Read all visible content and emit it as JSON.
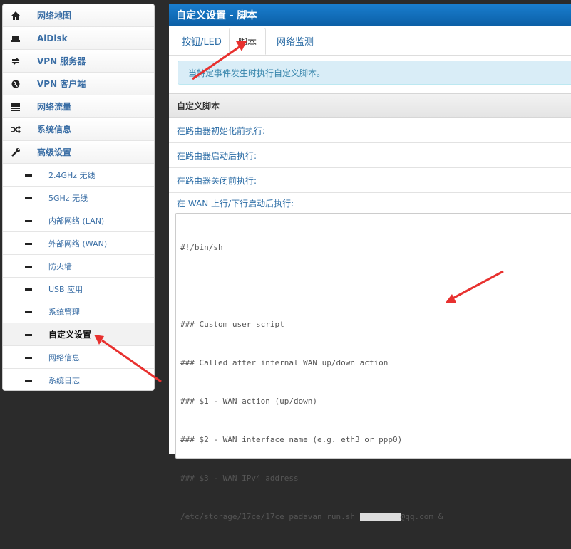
{
  "sidebar": {
    "items": [
      {
        "label": "网络地图",
        "icon": "home-icon"
      },
      {
        "label": "AiDisk",
        "icon": "disk-icon"
      },
      {
        "label": "VPN 服务器",
        "icon": "vpn-server-icon"
      },
      {
        "label": "VPN 客户端",
        "icon": "globe-icon"
      },
      {
        "label": "网络流量",
        "icon": "traffic-icon"
      },
      {
        "label": "系统信息",
        "icon": "shuffle-icon"
      },
      {
        "label": "高级设置",
        "icon": "wrench-icon"
      }
    ],
    "sub_items": [
      {
        "label": "2.4GHz 无线"
      },
      {
        "label": "5GHz 无线"
      },
      {
        "label": "内部网络 (LAN)"
      },
      {
        "label": "外部网络 (WAN)"
      },
      {
        "label": "防火墙"
      },
      {
        "label": "USB 应用"
      },
      {
        "label": "系统管理"
      },
      {
        "label": "自定义设置"
      },
      {
        "label": "网络信息"
      },
      {
        "label": "系统日志"
      }
    ],
    "active_sub_index": 7
  },
  "panel": {
    "title": "自定义设置 - 脚本",
    "tabs": [
      {
        "label": "按钮/LED"
      },
      {
        "label": "脚本"
      },
      {
        "label": "网络监测"
      }
    ],
    "active_tab_index": 1,
    "info_text": "当特定事件发生时执行自定义脚本。",
    "section_title": "自定义脚本",
    "rows": [
      {
        "label": "在路由器初始化前执行:"
      },
      {
        "label": "在路由器启动后执行:"
      },
      {
        "label": "在路由器关闭前执行:"
      },
      {
        "label": "在 WAN 上行/下行启动后执行:"
      }
    ],
    "script_lines": [
      "#!/bin/sh",
      "",
      "### Custom user script",
      "### Called after internal WAN up/down action",
      "### $1 - WAN action (up/down)",
      "### $2 - WAN interface name (e.g. eth3 or ppp0)",
      "### $3 - WAN IPv4 address"
    ],
    "script_last_line_prefix": "/etc/storage/17ce/17ce_padavan_run.sh ",
    "script_last_line_suffix": "@qq.com &"
  },
  "colors": {
    "header_blue": "#0b5fa5",
    "link_blue": "#2c6da6",
    "info_bg": "#d9edf7",
    "arrow_red": "#e8312f"
  }
}
